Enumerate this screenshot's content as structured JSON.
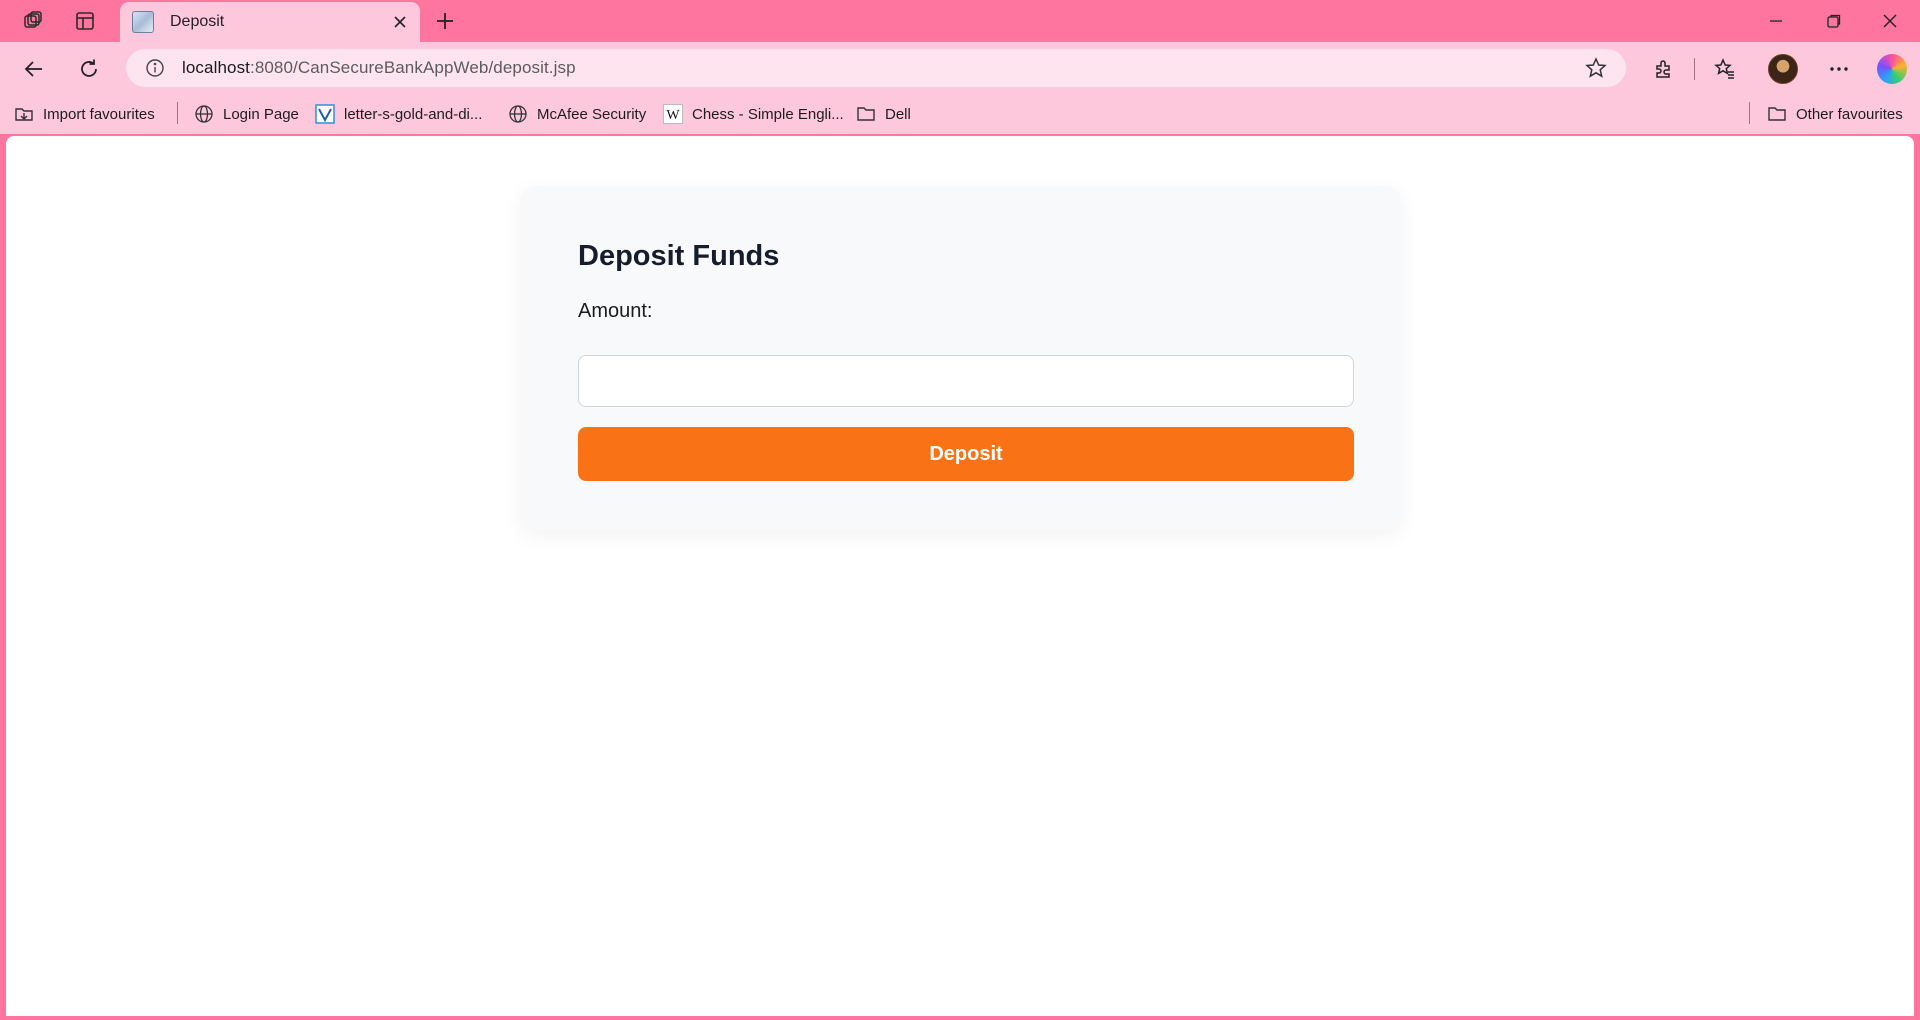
{
  "browser": {
    "tab": {
      "title": "Deposit"
    },
    "address": {
      "host": "localhost",
      "path": ":8080/CanSecureBankAppWeb/deposit.jsp"
    },
    "bookmarks": [
      {
        "label": "Import favourites",
        "icon": "import-icon"
      },
      {
        "label": "Login Page",
        "icon": "globe-icon"
      },
      {
        "label": "letter-s-gold-and-di...",
        "icon": "vector-icon"
      },
      {
        "label": "McAfee Security",
        "icon": "globe-icon"
      },
      {
        "label": "Chess - Simple Engli...",
        "icon": "wikipedia-icon"
      },
      {
        "label": "Dell",
        "icon": "folder-icon"
      }
    ],
    "other_favourites": "Other favourites"
  },
  "page": {
    "heading": "Deposit Funds",
    "amount_label": "Amount:",
    "amount_value": "",
    "deposit_button": "Deposit"
  },
  "colors": {
    "browser_accent": "#fe75a0",
    "toolbar": "#fdc8dc",
    "button": "#f97316",
    "heading": "#151d2d"
  }
}
